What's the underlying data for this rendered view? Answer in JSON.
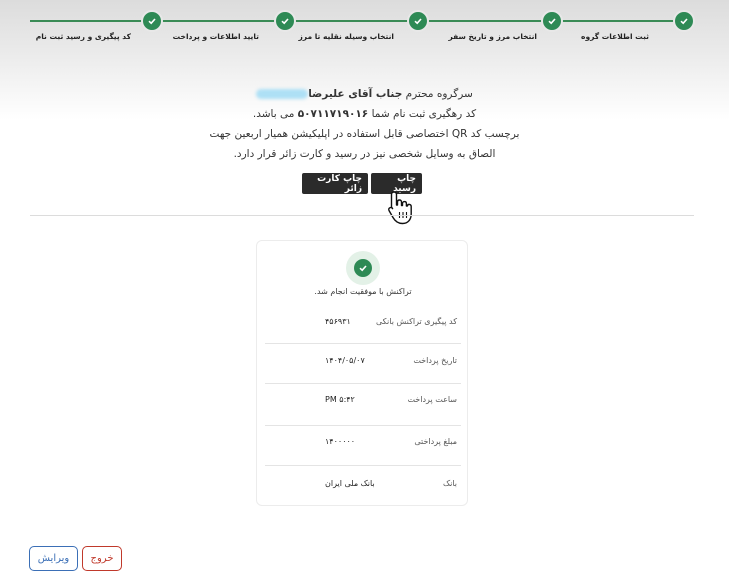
{
  "stepper": {
    "steps": [
      {
        "label": "ثبت اطلاعات گروه"
      },
      {
        "label": "انتخاب مرز و تاریخ سفر"
      },
      {
        "label": "انتخاب وسیله نقلیه تا مرز"
      },
      {
        "label": "تایید اطلاعات و پرداخت"
      },
      {
        "label": "کد پیگیری و رسید ثبت نام"
      }
    ],
    "accent_color": "#2e8a55"
  },
  "message": {
    "line1_prefix": "سرگروه محترم",
    "line1_name": "جناب آقای علیرضا",
    "line2_prefix": "کد رهگیری ثبت نام شما",
    "tracking_code": "۵۰۷۱۱۷۱۹۰۱۶",
    "line2_suffix": "می باشد.",
    "line3": "برچسب کد QR اختصاصی قابل استفاده در اپلیکیشن همیار اربعین جهت",
    "line4": "الصاق به وسایل شخصی نیز در رسید و کارت زائر قرار دارد."
  },
  "actions": {
    "print_receipt": "چاپ رسید",
    "print_card": "چاپ کارت زائر"
  },
  "receipt": {
    "success_text": "تراکنش با موفقیت انجام شد.",
    "rows": [
      {
        "label": "کد پیگیری تراکنش بانکی",
        "value": "۴۵۶۹۳۱"
      },
      {
        "label": "تاریخ پرداخت",
        "value": "۱۴۰۴/۰۵/۰۷"
      },
      {
        "label": "ساعت پرداخت",
        "value": "PM ۵:۴۲"
      },
      {
        "label": "مبلغ پرداختی",
        "value": "۱۴۰۰۰۰۰"
      },
      {
        "label": "بانک",
        "value": "بانک ملی ایران"
      }
    ]
  },
  "footer": {
    "edit_label": "ویرایش",
    "exit_label": "خروج",
    "edit_color": "#3b6fb6",
    "exit_color": "#c0392b"
  }
}
